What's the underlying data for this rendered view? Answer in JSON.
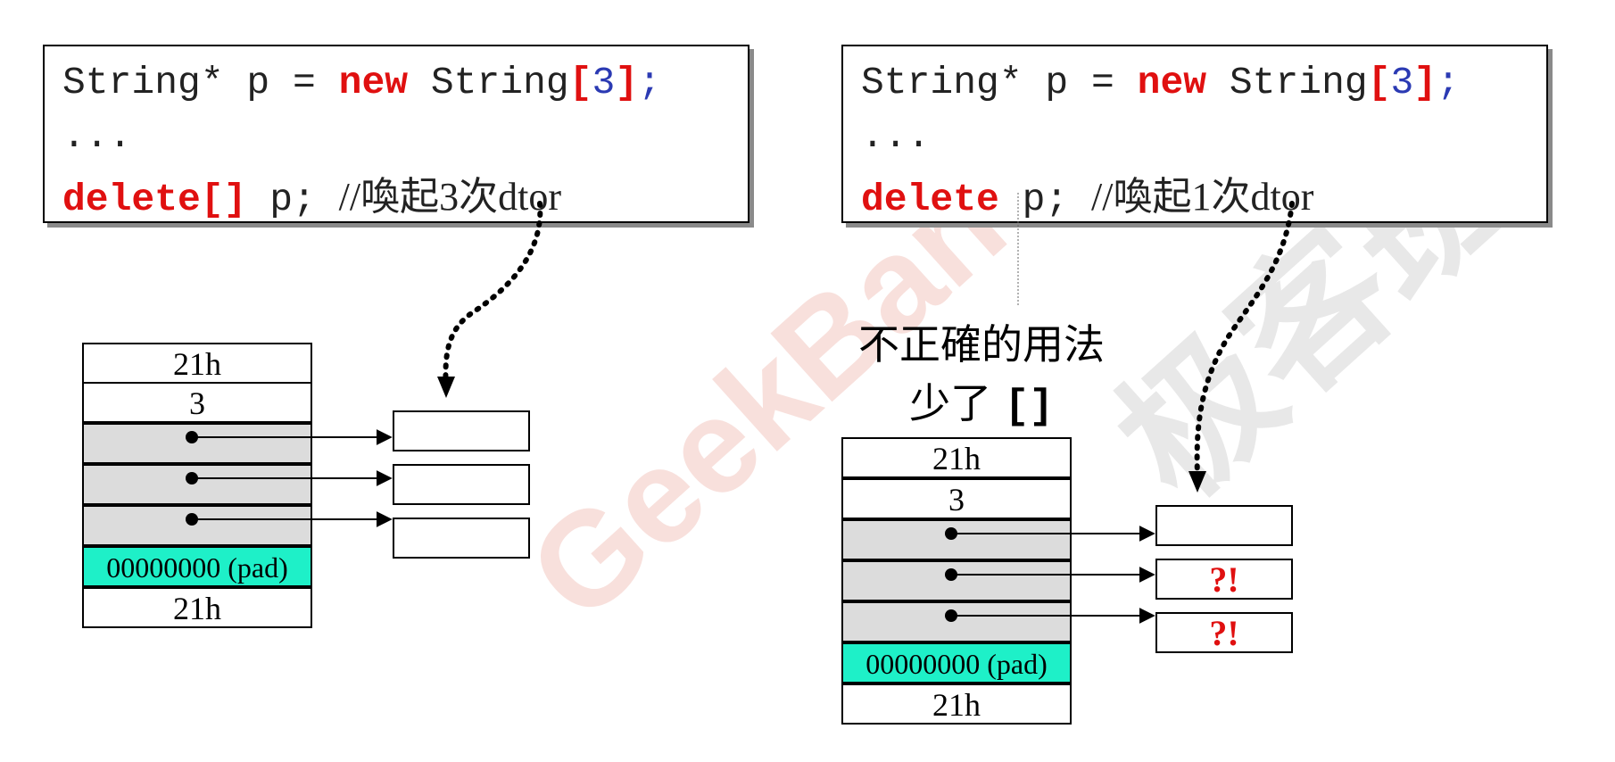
{
  "left": {
    "code": {
      "l1_type": "String* p = ",
      "l1_new": "new",
      "l1_cls": " String",
      "l1_open": "[",
      "l1_num": "3",
      "l1_close": "]",
      "l1_semi": ";",
      "l2": "...",
      "l3_kw": "delete[]",
      "l3_rest": " p; ",
      "l3_comment": "//喚起3次dtor"
    },
    "memory": [
      "21h",
      "3",
      "",
      "",
      "",
      "00000000 (pad)",
      "21h"
    ],
    "objects": [
      "",
      "",
      ""
    ]
  },
  "right": {
    "code": {
      "l1_type": "String* p = ",
      "l1_new": "new",
      "l1_cls": " String",
      "l1_open": "[",
      "l1_num": "3",
      "l1_close": "]",
      "l1_semi": ";",
      "l2": "...",
      "l3_kw": "delete",
      "l3_rest": " p; ",
      "l3_comment": "//喚起1次dtor"
    },
    "note": {
      "line1": "不正確的用法",
      "line2_text": "少了 ",
      "line2_brackets": "[]"
    },
    "memory": [
      "21h",
      "3",
      "",
      "",
      "",
      "00000000 (pad)",
      "21h"
    ],
    "objects": [
      "",
      "?!",
      "?!"
    ]
  },
  "watermark": {
    "latin": "GeekBand",
    "cjk": "极客班"
  },
  "colors": {
    "keyword": "#e01010",
    "number": "#2b3ab3",
    "pointer_cell": "#dcdcdc",
    "pad_cell": "#1ef0c8"
  }
}
